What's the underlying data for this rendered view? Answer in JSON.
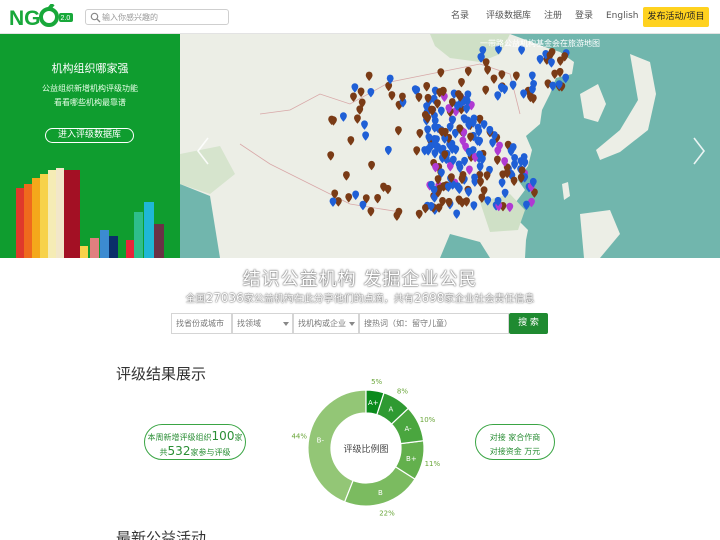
{
  "header": {
    "logo_text": "NGO",
    "logo_badge": "2.0",
    "search_placeholder": "输入你感兴趣的",
    "nav": [
      "名录",
      "评级数据库",
      "注册",
      "登录",
      "English"
    ],
    "publish_button": "发布活动/项目"
  },
  "promo": {
    "title": "机构组织哪家强",
    "line1": "公益组织新增机构评级功能",
    "line2": "看看哪些机构最靠谱",
    "button": "进入评级数据库"
  },
  "map": {
    "caption": "一带路公益机构基金会在旅游地图",
    "colors": {
      "blue": "#1f5fd6",
      "brown": "#7a3b16",
      "purple": "#b03ad3",
      "sea": "#71b6ad",
      "land": "#eceee6"
    }
  },
  "slogan": "结识公益机构 发掘企业公民",
  "stats": {
    "prefix": "全国",
    "org_count": "27036",
    "middle": "家公益机构在此分享他们的点滴，共有",
    "corp_count": "2698",
    "suffix": "家企业社会责任信息"
  },
  "filters": {
    "province": "找省份或城市",
    "field": "找领域",
    "org_type": "找机构或企业",
    "keyword_placeholder": "搜热词（如：留守儿童）",
    "search_button": "搜 索"
  },
  "rating": {
    "title": "评级结果展示",
    "left_pill": {
      "line1_prefix": "本周新增评级组织",
      "line1_num": "100",
      "line1_unit": "家",
      "line2_prefix": "共",
      "line2_num": "532",
      "line2_suffix": "家参与评级"
    },
    "right_pill": {
      "line1": "对接  家合作商",
      "line2": "对接资金  万元"
    },
    "chart_center": "评级比例图"
  },
  "chart_data": {
    "type": "pie",
    "title": "评级比例图",
    "categories": [
      "A+",
      "A",
      "A-",
      "B+",
      "B",
      "B-"
    ],
    "values": [
      5,
      8,
      10,
      11,
      22,
      44
    ],
    "value_labels": [
      "5%",
      "8%",
      "10%",
      "11%",
      "22%",
      "44%"
    ],
    "colors": [
      "#0a8a1c",
      "#2f9a32",
      "#4aa63f",
      "#63b04d",
      "#7bbb60",
      "#93c676"
    ]
  },
  "next_section": {
    "title": "最新公益活动"
  }
}
